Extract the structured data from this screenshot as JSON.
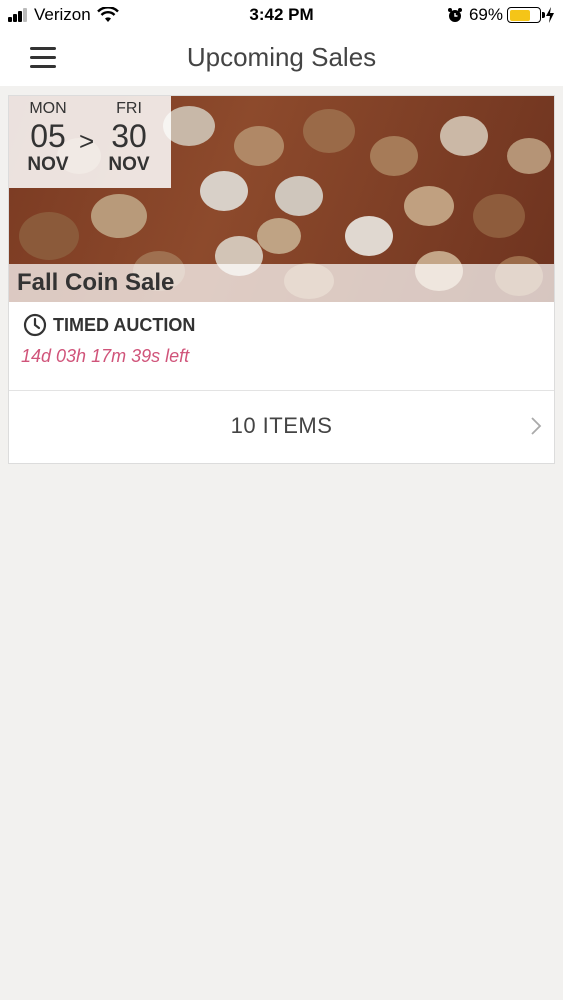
{
  "status_bar": {
    "carrier": "Verizon",
    "time": "3:42 PM",
    "battery_percent": "69%",
    "battery_level": 0.69
  },
  "nav": {
    "title": "Upcoming Sales",
    "menu_icon": "hamburger-menu-icon"
  },
  "sale": {
    "start": {
      "dow": "MON",
      "day": "05",
      "month": "NOV"
    },
    "separator": ">",
    "end": {
      "dow": "FRI",
      "day": "30",
      "month": "NOV"
    },
    "title": "Fall Coin Sale",
    "auction_type": "TIMED AUCTION",
    "auction_icon": "clock-icon",
    "time_left": "14d 03h 17m 39s left",
    "items_label": "10 ITEMS",
    "chevron_icon": "chevron-right-icon"
  },
  "colors": {
    "background": "#f2f1ef",
    "countdown": "#d0547a",
    "battery": "#f5c518"
  }
}
